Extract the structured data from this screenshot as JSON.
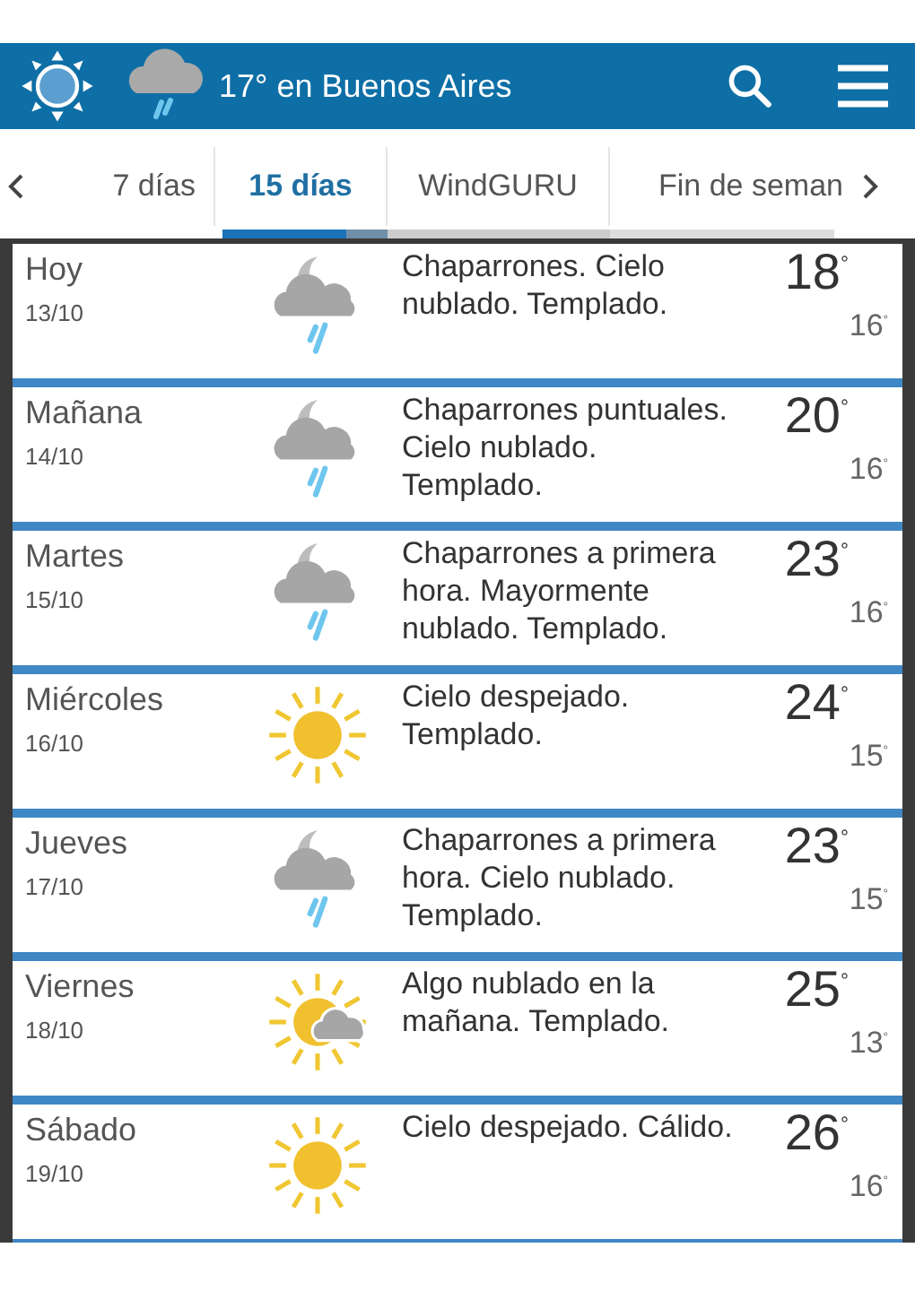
{
  "header": {
    "title": "17° en Buenos Aires"
  },
  "tabs": [
    {
      "label": "7 días",
      "selected": false
    },
    {
      "label": "15 días",
      "selected": true
    },
    {
      "label": "WindGURU",
      "selected": false
    },
    {
      "label": "Fin de seman",
      "selected": false
    }
  ],
  "days": [
    {
      "day": "Hoy",
      "date": "13/10",
      "kind": "rain-night",
      "description": "Chaparrones. Cielo nublado. Templado.",
      "high": "18$^{°}$",
      "low": "16$^{°}$"
    },
    {
      "day": "Mañana",
      "date": "14/10",
      "kind": "rain-night",
      "description": "Chaparrones puntuales. Cielo nublado. Templado.",
      "high": "20$^{°}$",
      "low": "16$^{°}$"
    },
    {
      "day": "Martes",
      "date": "15/10",
      "kind": "rain-night",
      "description": "Chaparrones a primera hora. Mayormente nublado. Templado.",
      "high": "23$^{°}$",
      "low": "16$^{°}$"
    },
    {
      "day": "Miércoles",
      "date": "16/10",
      "kind": "sun",
      "description": "Cielo despejado. Templado.",
      "high": "24$^{°}$",
      "low": "15$^{°}$"
    },
    {
      "day": "Jueves",
      "date": "17/10",
      "kind": "rain-night",
      "description": "Chaparrones a primera hora. Cielo nublado. Templado.",
      "high": "23$^{°}$",
      "low": "15$^{°}$"
    },
    {
      "day": "Viernes",
      "date": "18/10",
      "kind": "sun-cloud",
      "description": "Algo nublado en la mañana. Templado.",
      "high": "25$^{°}$",
      "low": "13$^{°}$"
    },
    {
      "day": "Sábado",
      "date": "19/10",
      "kind": "sun",
      "description": "Cielo despejado. Cálido.",
      "high": "26$^{°}$",
      "low": "16$^{°}$"
    }
  ]
}
